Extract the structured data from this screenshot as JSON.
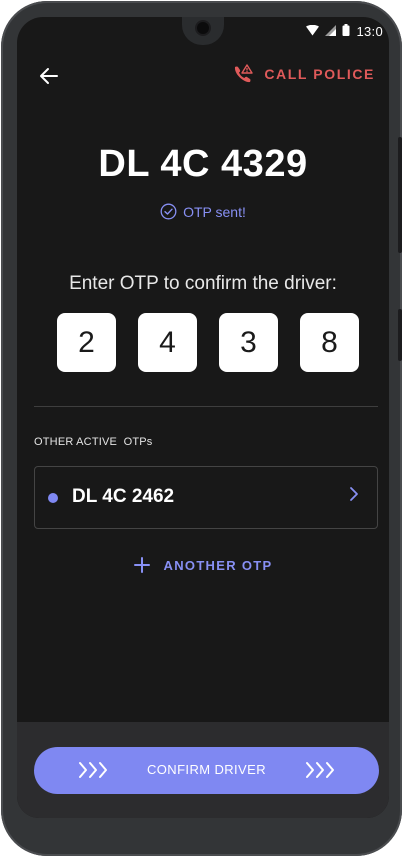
{
  "status_bar": {
    "time": "13:0",
    "icons": [
      "wifi-icon",
      "cellular-signal-icon",
      "battery-icon"
    ]
  },
  "topbar": {
    "back_icon": "back-arrow-icon",
    "call_police_label": "CALL POLICE",
    "call_police_icon": "phone-alert-icon"
  },
  "vehicle": {
    "plate": "DL 4C 4329"
  },
  "otp_status": {
    "text": "OTP sent!",
    "icon": "check-circle-icon"
  },
  "otp_entry": {
    "prompt": "Enter OTP to confirm the driver:",
    "digits": [
      "2",
      "4",
      "3",
      "8"
    ]
  },
  "other_otps": {
    "section_label": "OTHER ACTIVE  OTPs",
    "items": [
      {
        "label": "DL 4C 2462"
      }
    ]
  },
  "another_otp": {
    "label": "ANOTHER OTP",
    "icon": "plus-icon"
  },
  "confirm": {
    "label": "CONFIRM DRIVER",
    "left_icon": "triple-chevron-right-icon",
    "right_icon": "triple-chevron-right-icon"
  },
  "colors": {
    "accent": "#7f88f2",
    "danger": "#e05a5a",
    "background": "#181818",
    "panel": "#2c2c2e"
  }
}
